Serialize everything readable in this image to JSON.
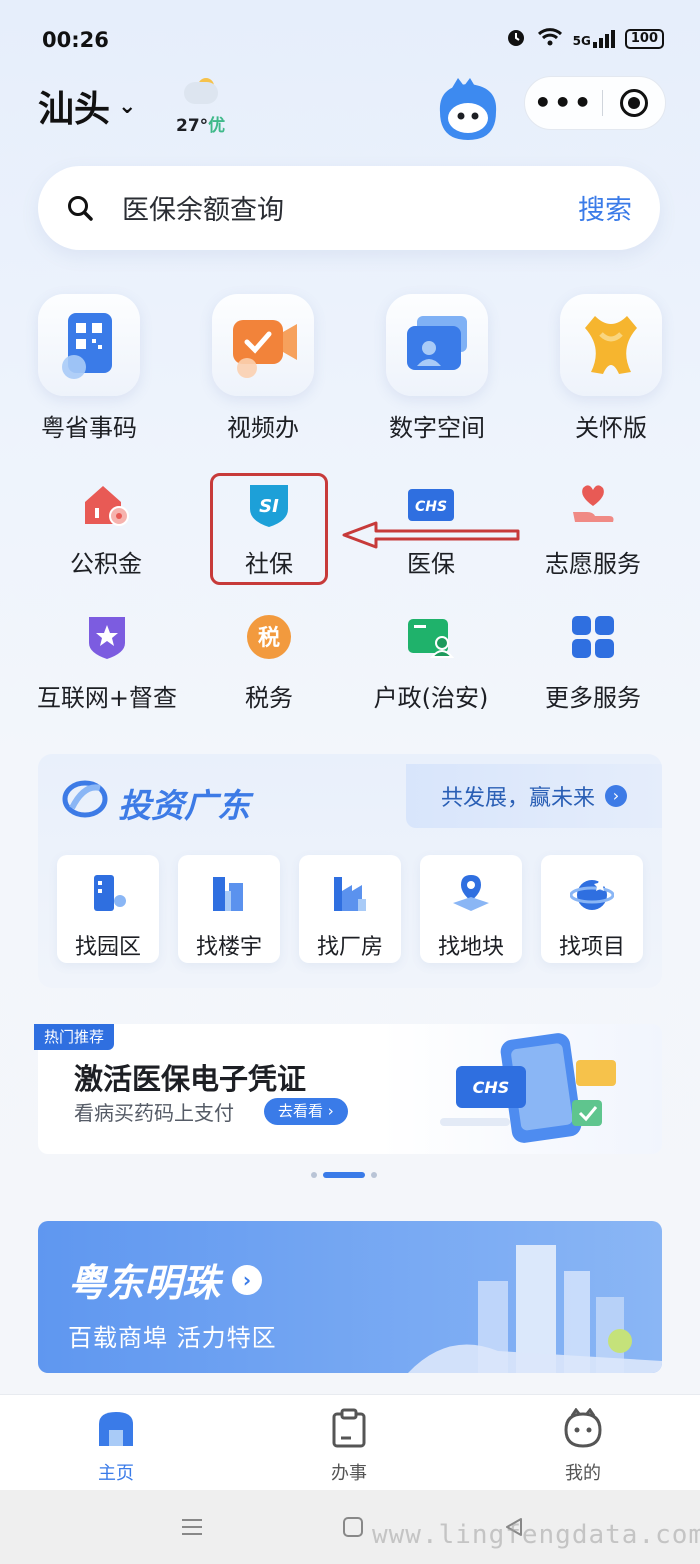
{
  "status_bar": {
    "time": "00:26",
    "network": "5G",
    "battery": "100"
  },
  "header": {
    "city": "汕头",
    "temperature": "27°",
    "air_quality": "优"
  },
  "search": {
    "placeholder": "医保余额查询",
    "button": "搜索"
  },
  "main_services": [
    {
      "label": "粤省事码",
      "icon": "qr-code-icon"
    },
    {
      "label": "视频办",
      "icon": "video-icon"
    },
    {
      "label": "数字空间",
      "icon": "folder-icon"
    },
    {
      "label": "关怀版",
      "icon": "ribbon-icon"
    }
  ],
  "services_row1": [
    {
      "label": "公积金",
      "icon": "house-fund-icon"
    },
    {
      "label": "社保",
      "icon": "social-security-icon",
      "icon_text": "SI"
    },
    {
      "label": "医保",
      "icon": "medical-insurance-icon",
      "icon_text": "CHS"
    },
    {
      "label": "志愿服务",
      "icon": "heart-hand-icon"
    }
  ],
  "services_row2": [
    {
      "label": "互联网+督查",
      "icon": "star-shield-icon"
    },
    {
      "label": "税务",
      "icon": "tax-icon",
      "icon_text": "税"
    },
    {
      "label": "户政(治安)",
      "icon": "id-card-icon"
    },
    {
      "label": "更多服务",
      "icon": "grid-icon"
    }
  ],
  "invest": {
    "title": "投资广东",
    "slogan": "共发展，赢未来",
    "items": [
      {
        "label": "找园区",
        "icon": "park-icon"
      },
      {
        "label": "找楼宇",
        "icon": "building-icon"
      },
      {
        "label": "找厂房",
        "icon": "factory-icon"
      },
      {
        "label": "找地块",
        "icon": "land-icon"
      },
      {
        "label": "找项目",
        "icon": "project-icon"
      }
    ]
  },
  "banner": {
    "tag": "热门推荐",
    "title": "激活医保电子凭证",
    "subtitle": "看病买药码上支付",
    "button": "去看看",
    "card_text": "CHS"
  },
  "pearl": {
    "title": "粤东明珠",
    "subtitle": "百载商埠  活力特区"
  },
  "tabbar": [
    {
      "label": "主页",
      "active": true
    },
    {
      "label": "办事",
      "active": false
    },
    {
      "label": "我的",
      "active": false
    }
  ],
  "watermark": "www.lingfengdata.com",
  "colors": {
    "accent": "#3a7be8",
    "highlight_box": "#c73a3a"
  }
}
